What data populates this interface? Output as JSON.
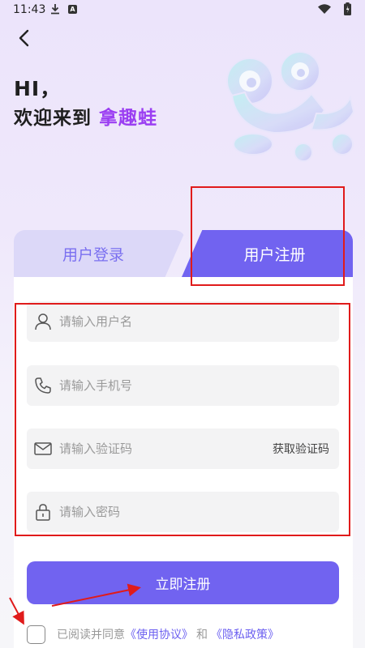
{
  "status_bar": {
    "time": "11:43"
  },
  "header": {
    "greeting": "HI，",
    "welcome_prefix": "欢迎来到 ",
    "brand": "拿趣蛙"
  },
  "tabs": {
    "login": "用户登录",
    "register": "用户注册"
  },
  "form": {
    "username_placeholder": "请输入用户名",
    "phone_placeholder": "请输入手机号",
    "code_placeholder": "请输入验证码",
    "get_code": "获取验证码",
    "password_placeholder": "请输入密码",
    "submit": "立即注册"
  },
  "agreement": {
    "prefix": "已阅读并同意",
    "terms": "《使用协议》",
    "and": "和",
    "privacy": "《隐私政策》"
  },
  "colors": {
    "accent": "#7163f0",
    "brand": "#9b3ff2",
    "annotation": "#e01b1b"
  }
}
